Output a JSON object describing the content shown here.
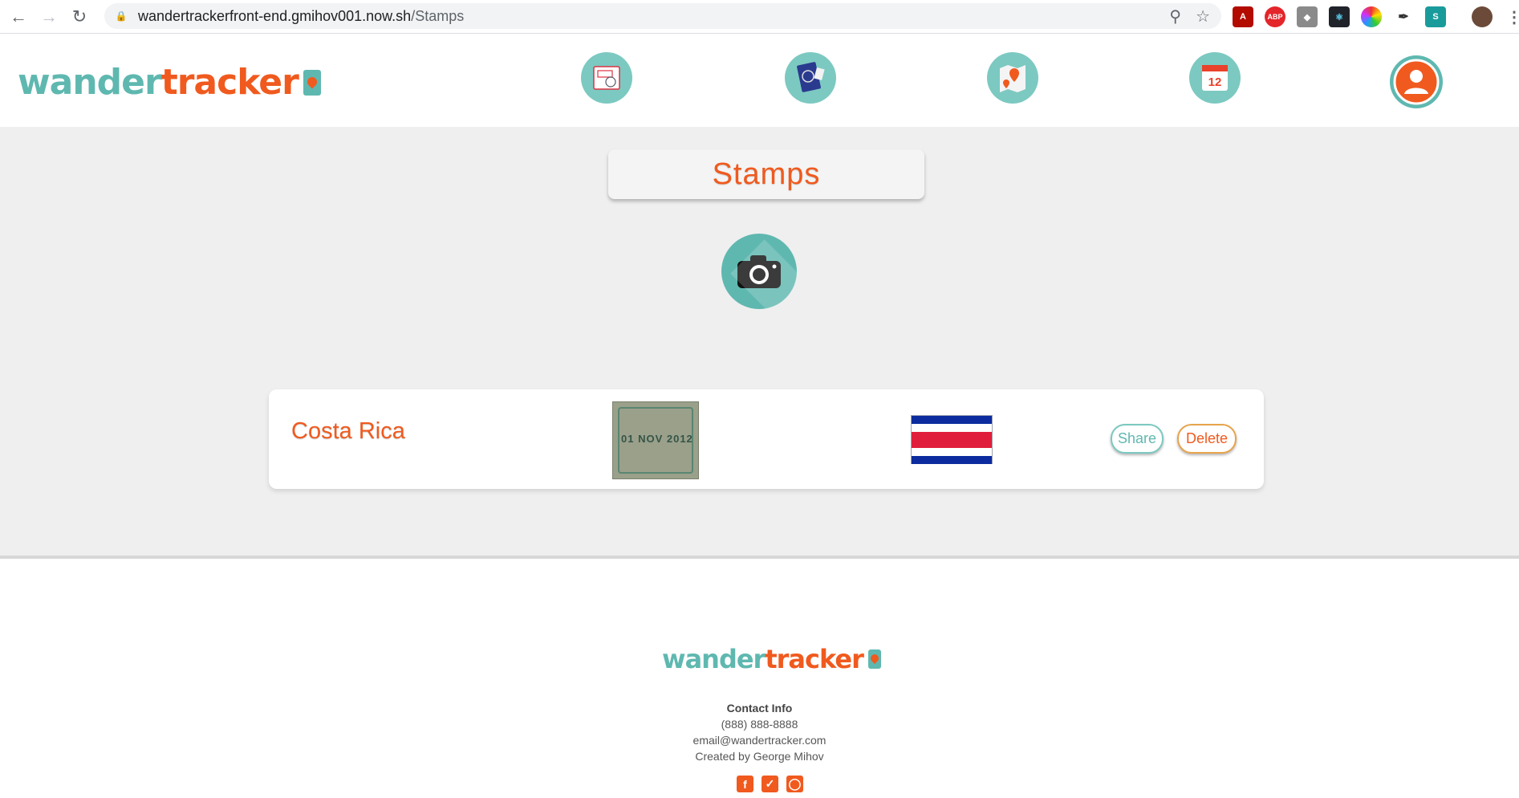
{
  "browser": {
    "url_host": "wandertrackerfront-end.gmihov001.now.sh",
    "url_path": "/Stamps",
    "extensions": [
      "pdf-extension-icon",
      "adblock-icon",
      "cube-extension-icon",
      "react-devtools-icon",
      "color-wheel-icon",
      "eyedropper-icon",
      "s-extension-icon"
    ]
  },
  "header": {
    "logo_part1": "wander",
    "logo_part2": "tracker",
    "nav": [
      {
        "name": "stamps-nav-icon"
      },
      {
        "name": "passport-nav-icon"
      },
      {
        "name": "map-nav-icon"
      },
      {
        "name": "calendar-nav-icon"
      },
      {
        "name": "profile-nav-icon"
      }
    ],
    "calendar_day": "12"
  },
  "main": {
    "title": "Stamps",
    "stamps": [
      {
        "country": "Costa Rica",
        "stamp_date": "01 NOV 2012",
        "share_label": "Share",
        "delete_label": "Delete"
      }
    ]
  },
  "footer": {
    "logo_part1": "wander",
    "logo_part2": "tracker",
    "contact_heading": "Contact Info",
    "phone": "(888) 888-8888",
    "email": "email@wandertracker.com",
    "credit": "Created by George Mihov"
  },
  "colors": {
    "teal": "#5fb8b0",
    "orange": "#f05a1e",
    "background": "#efefef"
  }
}
